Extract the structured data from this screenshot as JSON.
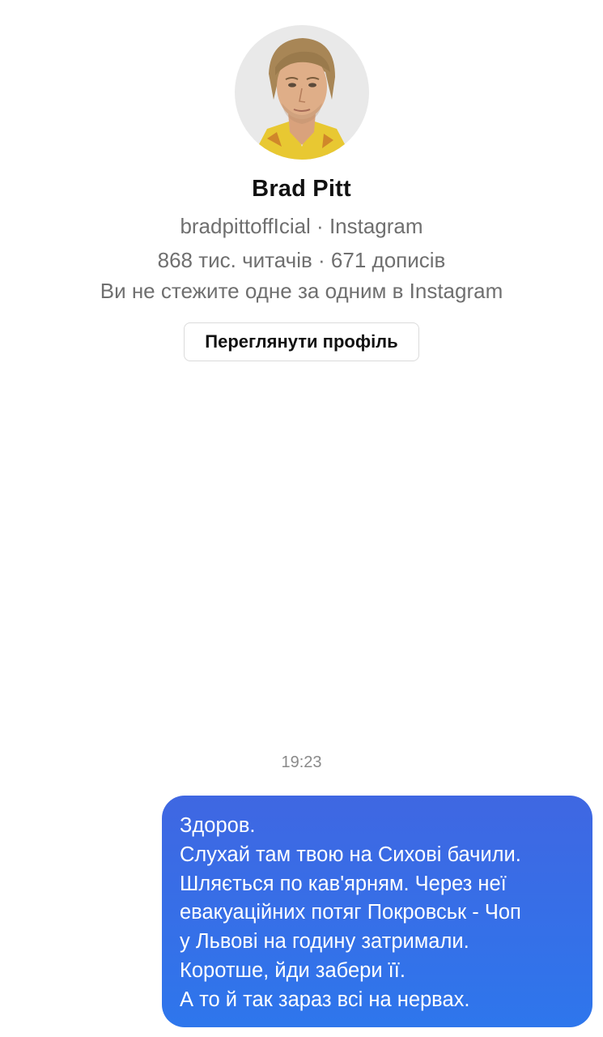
{
  "profile": {
    "name": "Brad Pitt",
    "handle_line": "bradpittoffIcial · Instagram",
    "stats_line": "868 тис. читачів · 671 дописів",
    "follow_status": "Ви не стежите одне за одним в Instagram",
    "view_profile_button": "Переглянути профіль",
    "avatar_icon": "profile-photo"
  },
  "conversation": {
    "timestamp": "19:23",
    "message": {
      "lines": [
        "Здоров.",
        "Слухай там твою на Сихові бачили.",
        "Шляється по кав'ярням. Через неї",
        "евакуаційних потяг Покровськ - Чоп",
        "у Львові на годину затримали.",
        "Коротше, йди забери її.",
        "А то й так зараз всі на нервах."
      ],
      "bubble_color": "#3a6ee8"
    }
  }
}
